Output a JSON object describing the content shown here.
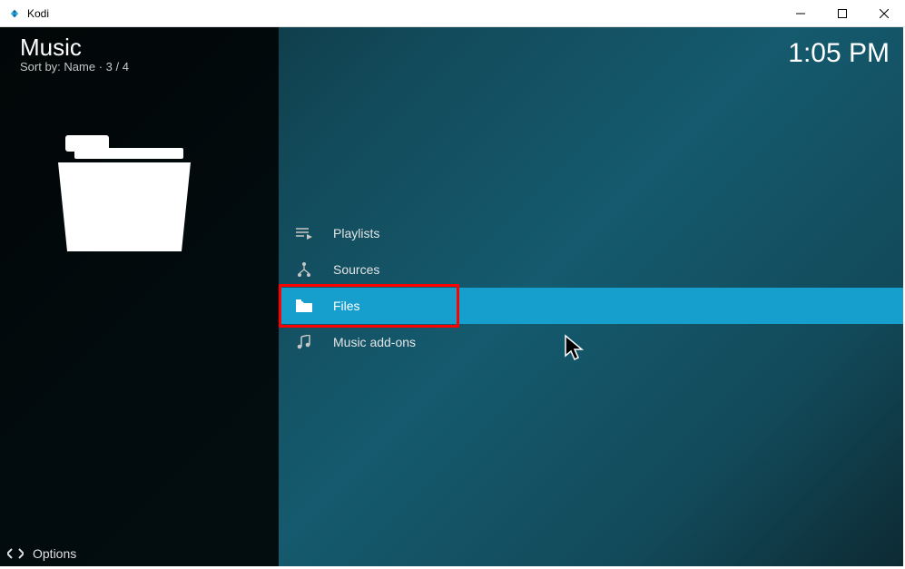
{
  "window": {
    "title": "Kodi"
  },
  "header": {
    "section": "Music",
    "sort_line": "Sort by: Name  ·  3 / 4"
  },
  "clock": "1:05 PM",
  "menu": {
    "items": [
      {
        "label": "Playlists",
        "icon": "playlist-icon"
      },
      {
        "label": "Sources",
        "icon": "sources-icon"
      },
      {
        "label": "Files",
        "icon": "folder-icon"
      },
      {
        "label": "Music add-ons",
        "icon": "music-addons-icon"
      }
    ],
    "selected_index": 2,
    "highlight_index": 2
  },
  "footer": {
    "options_label": "Options"
  },
  "colors": {
    "highlight": "#169fcd",
    "annotation": "#ff0000"
  }
}
